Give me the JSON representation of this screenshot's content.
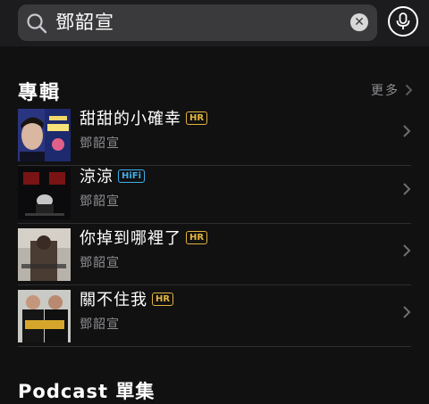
{
  "search": {
    "query": "鄧韶宣"
  },
  "albums_section": {
    "title": "專輯",
    "more_label": "更多",
    "items": [
      {
        "title": "甜甜的小確幸",
        "badge": "HR",
        "artist": "鄧韶宣"
      },
      {
        "title": "涼涼",
        "badge": "HiFi",
        "artist": "鄧韶宣"
      },
      {
        "title": "你掉到哪裡了",
        "badge": "HR",
        "artist": "鄧韶宣"
      },
      {
        "title": "關不住我",
        "badge": "HR",
        "artist": "鄧韶宣"
      }
    ]
  },
  "podcast_section": {
    "title": "Podcast 單集"
  },
  "colors": {
    "background": "#111111",
    "search_field": "#3a3a3c",
    "hr_badge": "#e4b43c",
    "hifi_badge": "#43aee8",
    "secondary_text": "#8e8e93"
  },
  "icons": [
    "search-icon",
    "clear-icon",
    "voice-search-icon",
    "chevron-right-icon"
  ]
}
